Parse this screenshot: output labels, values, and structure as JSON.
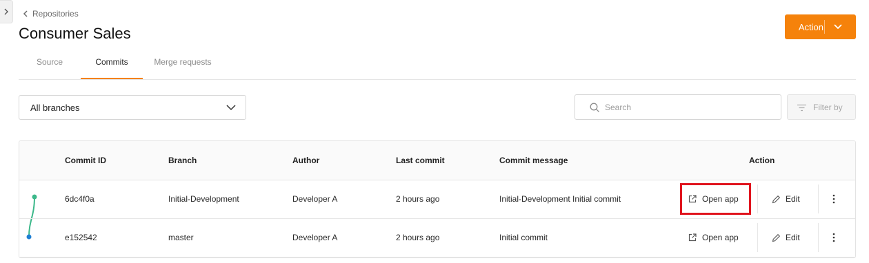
{
  "breadcrumb": {
    "label": "Repositories",
    "icon": "chevron-left-icon"
  },
  "page": {
    "title": "Consumer Sales"
  },
  "header": {
    "action_label": "Action",
    "action_color": "#f5820b"
  },
  "tabs": [
    {
      "label": "Source",
      "active": false
    },
    {
      "label": "Commits",
      "active": true
    },
    {
      "label": "Merge requests",
      "active": false
    }
  ],
  "filters": {
    "branch_selected": "All branches",
    "search_placeholder": "Search",
    "filter_label": "Filter by"
  },
  "table": {
    "columns": [
      "Commit ID",
      "Branch",
      "Author",
      "Last commit",
      "Commit message",
      "Action"
    ],
    "rows": [
      {
        "commit_id": "6dc4f0a",
        "branch": "Initial-Development",
        "author": "Developer A",
        "last_commit": "2 hours ago",
        "message": "Initial-Development Initial commit",
        "open_label": "Open app",
        "edit_label": "Edit",
        "highlighted": true,
        "graph_color": "#3cb88a"
      },
      {
        "commit_id": "e152542",
        "branch": "master",
        "author": "Developer A",
        "last_commit": "2 hours ago",
        "message": "Initial commit",
        "open_label": "Open app",
        "edit_label": "Edit",
        "highlighted": false,
        "graph_color": "#1e7fd4"
      }
    ]
  }
}
